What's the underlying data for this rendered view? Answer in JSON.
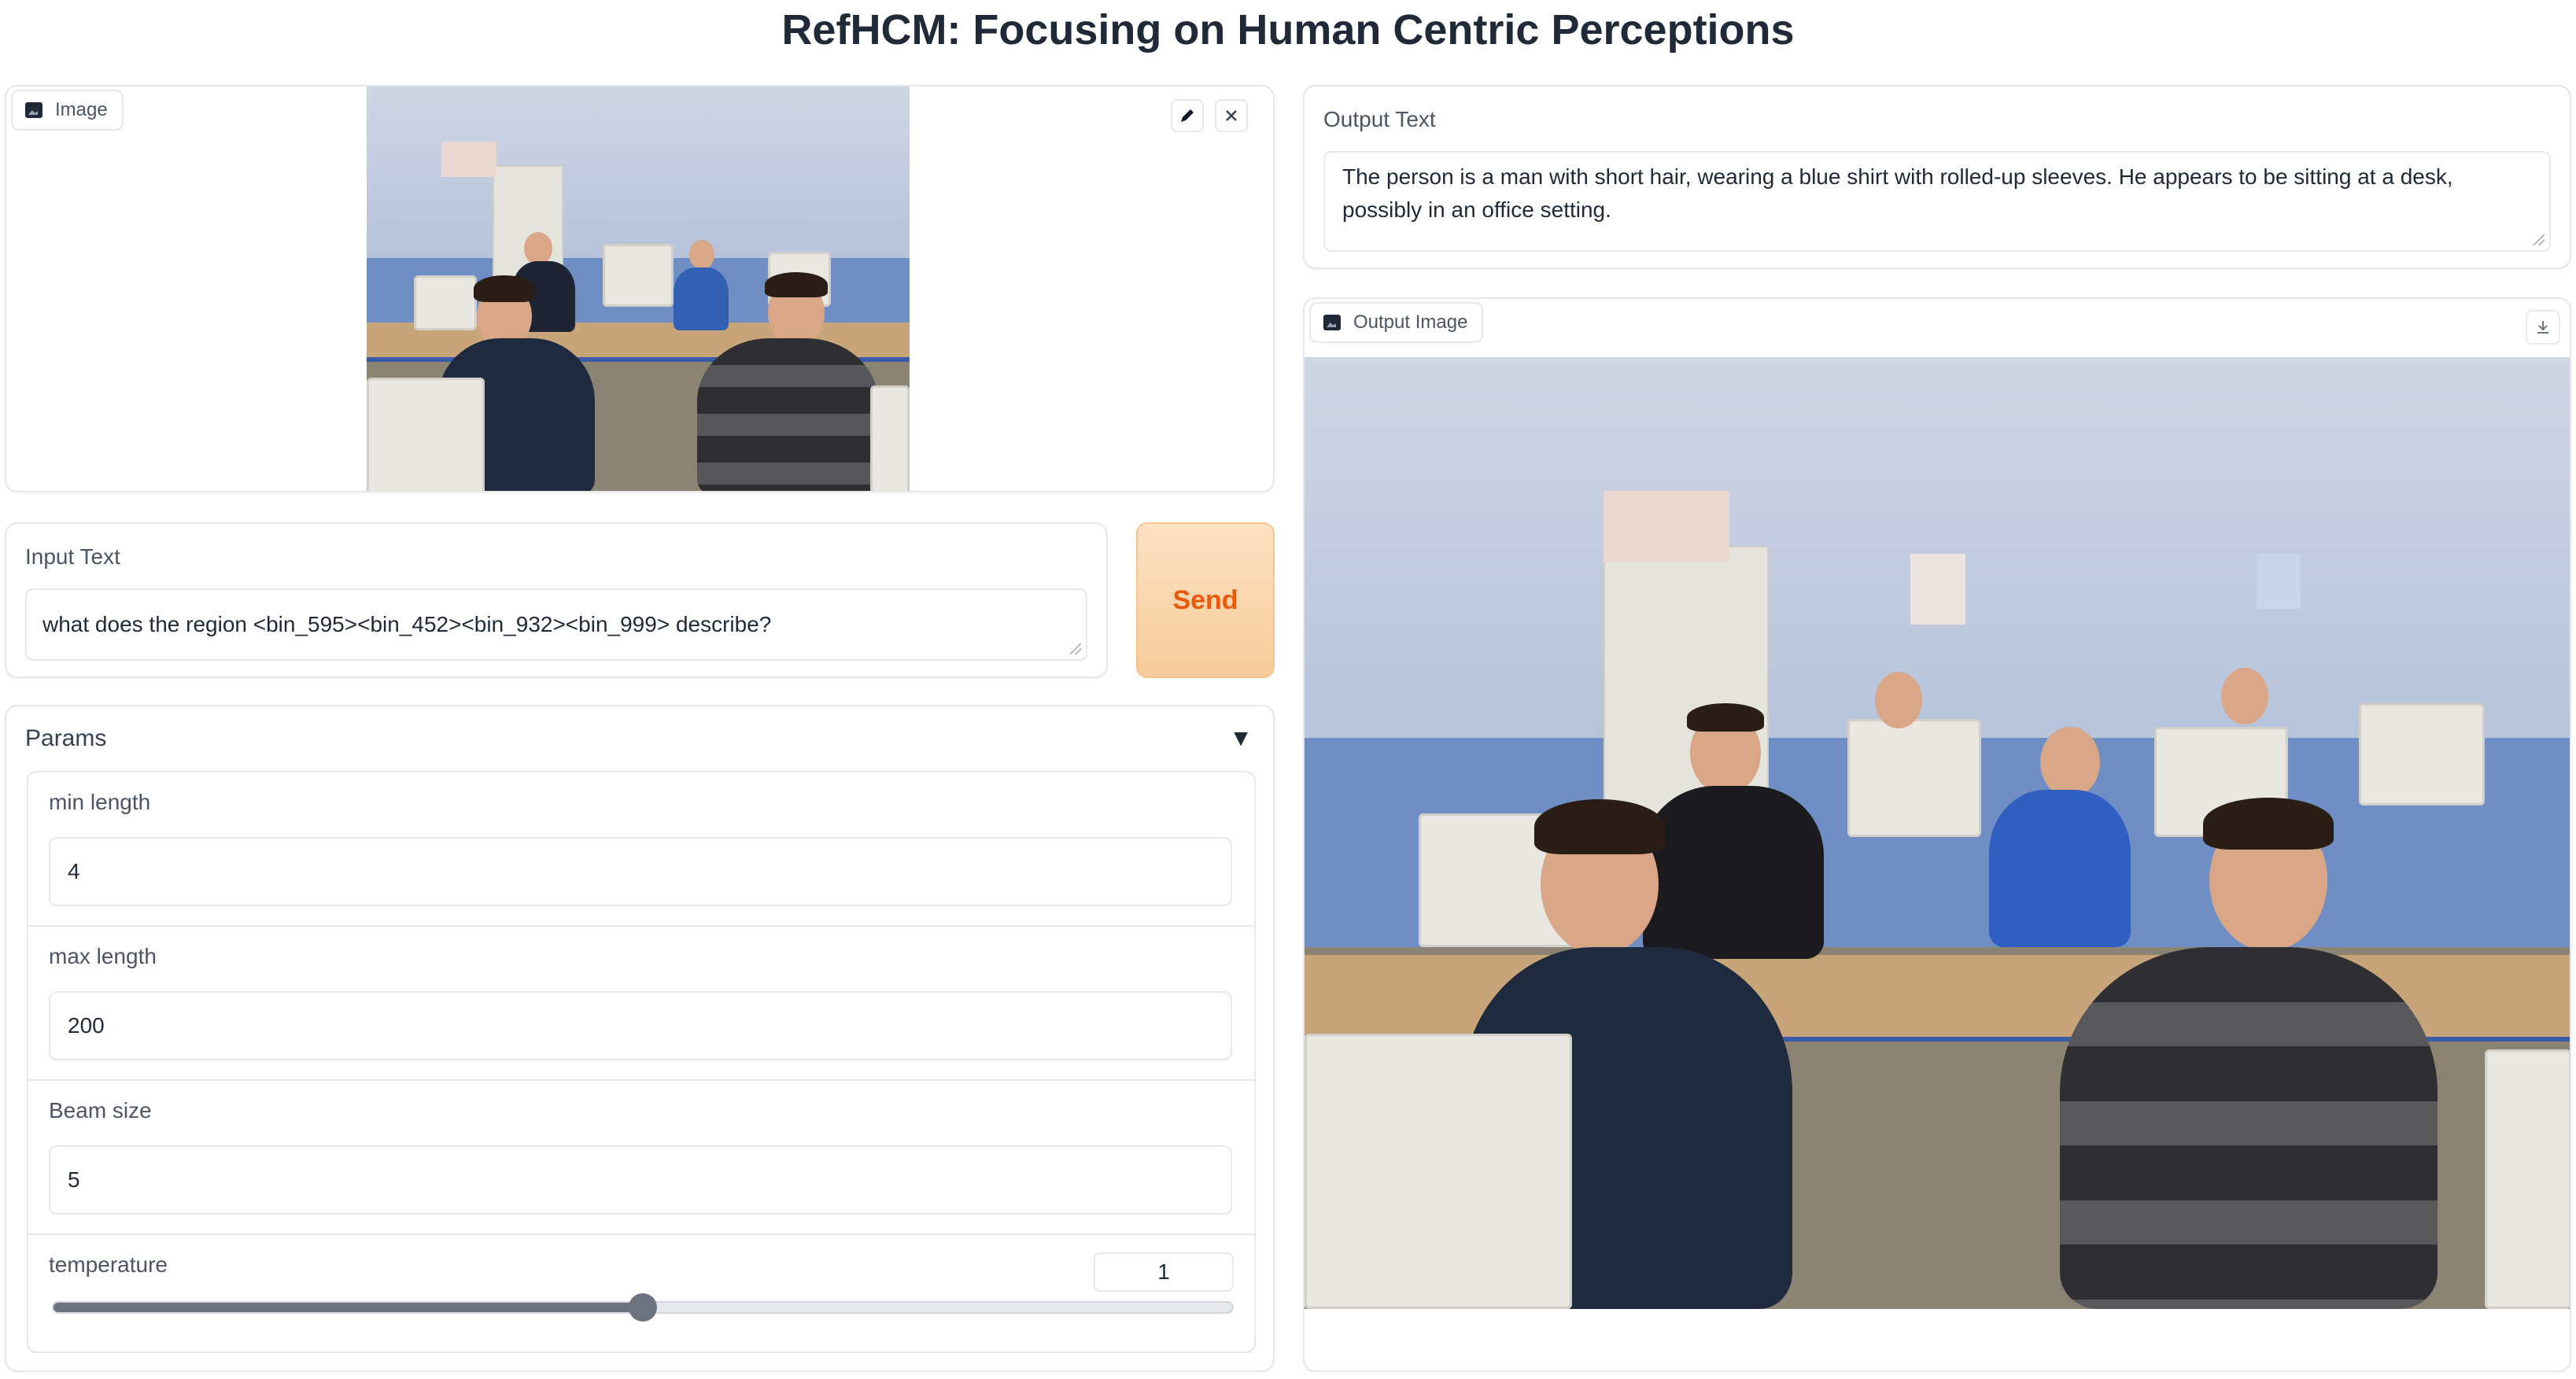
{
  "page": {
    "title": "RefHCM: Focusing on Human Centric Perceptions"
  },
  "image_input": {
    "label": "Image",
    "edit_icon": "pencil-icon",
    "close_icon": "close-icon"
  },
  "input_text": {
    "label": "Input Text",
    "value": "what does the region <bin_595><bin_452><bin_932><bin_999> describe?"
  },
  "send_button": {
    "label": "Send",
    "color": "#ea580c",
    "background": "#f7cc9a"
  },
  "params": {
    "header": "Params",
    "toggle_icon": "triangle-down-icon",
    "min_length": {
      "label": "min length",
      "value": "4"
    },
    "max_length": {
      "label": "max length",
      "value": "200"
    },
    "beam_size": {
      "label": "Beam size",
      "value": "5"
    },
    "temperature": {
      "label": "temperature",
      "value": "1",
      "slider_fraction": 0.5
    }
  },
  "output_text": {
    "label": "Output Text",
    "value": "The person is a man with short hair, wearing a blue shirt with rolled-up sleeves. He appears to be sitting at a desk, possibly in an office setting."
  },
  "output_image": {
    "label": "Output Image",
    "download_icon": "download-icon"
  }
}
